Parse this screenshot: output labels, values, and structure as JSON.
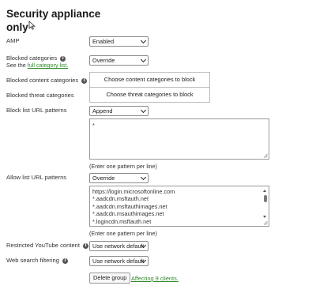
{
  "title_line1": "Security appliance",
  "title_line2": "only",
  "amp": {
    "label": "AMP",
    "value": "Enabled"
  },
  "blocked_categories": {
    "label": "Blocked categories",
    "see_text": "See the ",
    "link": "full category list.",
    "value": "Override"
  },
  "blocked_content": {
    "label": "Blocked content categories",
    "button": "Choose content categories to block"
  },
  "blocked_threat": {
    "label": "Blocked threat categories",
    "button": "Choose threat categories to block"
  },
  "block_list": {
    "label": "Block list URL patterns",
    "mode": "Append",
    "value": "*",
    "hint": "(Enter one pattern per line)"
  },
  "allow_list": {
    "label": "Allow list URL patterns",
    "mode": "Override",
    "urls": [
      "https://login.microsoftonline.com",
      "*.aadcdn.msftauth.net",
      "*.aadcdn.msftauthimages.net",
      "*.aadcdn.msauthimages.net",
      "*.logincdn.msftauth.net"
    ],
    "hint": "(Enter one pattern per line)"
  },
  "restricted_youtube": {
    "label": "Restricted YouTube content",
    "value": "Use network default"
  },
  "web_search": {
    "label": "Web search filtering",
    "value": "Use network default"
  },
  "delete_group": "Delete group",
  "affecting": "Affecting 9 clients.",
  "info_glyph": "i",
  "colors": {
    "link": "#2f8a29",
    "border": "#8a8a8a"
  }
}
